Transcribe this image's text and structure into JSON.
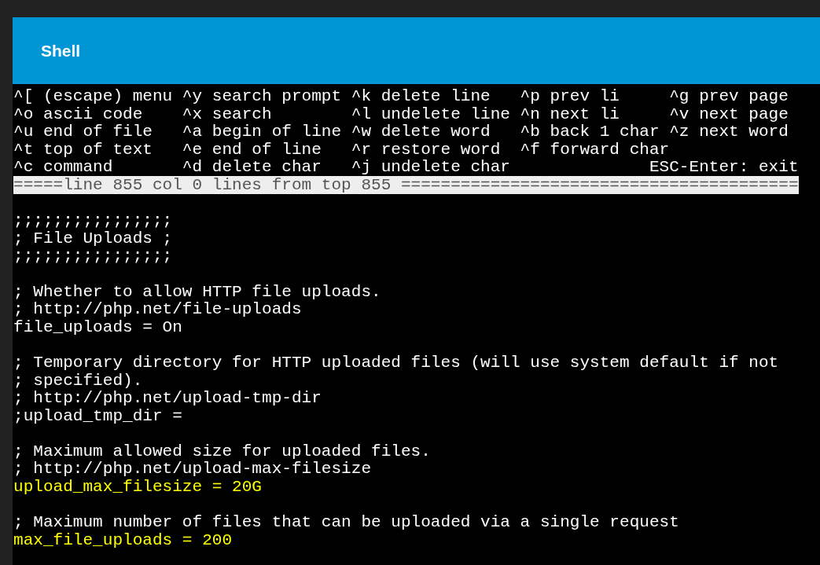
{
  "window": {
    "title": "Shell"
  },
  "help_lines": [
    "^[ (escape) menu ^y search prompt ^k delete line   ^p prev li     ^g prev page",
    "^o ascii code    ^x search        ^l undelete line ^n next li     ^v next page",
    "^u end of file   ^a begin of line ^w delete word   ^b back 1 char ^z next word",
    "^t top of text   ^e end of line   ^r restore word  ^f forward char",
    "^c command       ^d delete char   ^j undelete char              ESC-Enter: exit"
  ],
  "status_bar": "=====line 855 col 0 lines from top 855 ========================================",
  "blocks": [
    [
      {
        "text": ";;;;;;;;;;;;;;;;",
        "highlighted": false
      },
      {
        "text": "; File Uploads ;",
        "highlighted": false
      },
      {
        "text": ";;;;;;;;;;;;;;;;",
        "highlighted": false
      }
    ],
    [
      {
        "text": "; Whether to allow HTTP file uploads.",
        "highlighted": false
      },
      {
        "text": "; http://php.net/file-uploads",
        "highlighted": false
      },
      {
        "text": "file_uploads = On",
        "highlighted": false
      }
    ],
    [
      {
        "text": "; Temporary directory for HTTP uploaded files (will use system default if not",
        "highlighted": false
      },
      {
        "text": "; specified).",
        "highlighted": false
      },
      {
        "text": "; http://php.net/upload-tmp-dir",
        "highlighted": false
      },
      {
        "text": ";upload_tmp_dir =",
        "highlighted": false
      }
    ],
    [
      {
        "text": "; Maximum allowed size for uploaded files.",
        "highlighted": false
      },
      {
        "text": "; http://php.net/upload-max-filesize",
        "highlighted": false
      },
      {
        "text": "upload_max_filesize = 20G",
        "highlighted": true
      }
    ],
    [
      {
        "text": "; Maximum number of files that can be uploaded via a single request",
        "highlighted": false
      },
      {
        "text": "max_file_uploads = 200",
        "highlighted": true
      }
    ]
  ]
}
